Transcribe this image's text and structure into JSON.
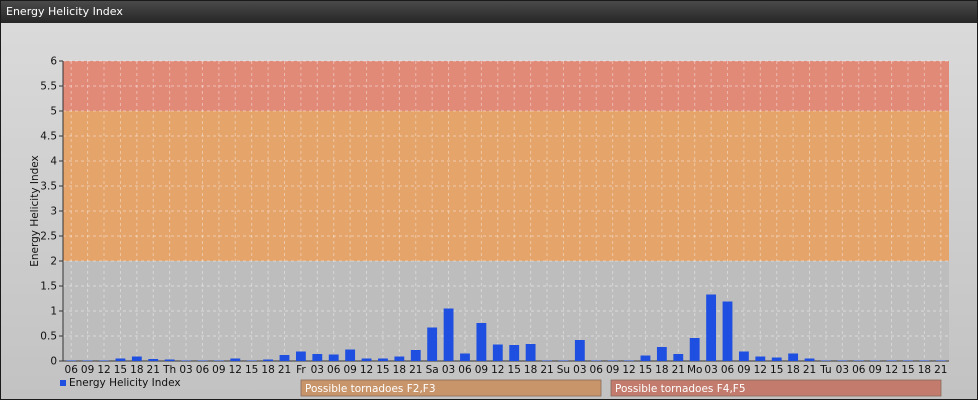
{
  "window": {
    "title": "Energy Helicity Index"
  },
  "chart_data": {
    "type": "bar",
    "ylabel": "Energy Helicity Index",
    "ylim": [
      0,
      6
    ],
    "yticks": [
      "0",
      "0.5",
      "1",
      "1.5",
      "2",
      "2.5",
      "3",
      "3.5",
      "4",
      "4.5",
      "5",
      "5.5",
      "6"
    ],
    "grid": true,
    "categories": [
      "06",
      "09",
      "12",
      "15",
      "18",
      "21",
      "Th",
      "03",
      "06",
      "09",
      "12",
      "15",
      "18",
      "21",
      "Fr",
      "03",
      "06",
      "09",
      "12",
      "15",
      "18",
      "21",
      "Sa",
      "03",
      "06",
      "09",
      "12",
      "15",
      "18",
      "21",
      "Su",
      "03",
      "06",
      "09",
      "12",
      "15",
      "18",
      "21",
      "Mo",
      "03",
      "06",
      "09",
      "12",
      "15",
      "18",
      "21",
      "Tu",
      "03",
      "06",
      "09",
      "12",
      "15",
      "18",
      "21"
    ],
    "series": [
      {
        "name": "Energy Helicity Index",
        "color": "#1f4fe0",
        "values": [
          0.01,
          0.01,
          0.01,
          0.05,
          0.09,
          0.04,
          0.03,
          0.01,
          0.01,
          0.01,
          0.05,
          0.01,
          0.03,
          0.12,
          0.19,
          0.14,
          0.13,
          0.23,
          0.05,
          0.05,
          0.09,
          0.22,
          0.67,
          1.05,
          0.15,
          0.76,
          0.33,
          0.32,
          0.34,
          0.01,
          0.01,
          0.42,
          0.01,
          0.01,
          0.01,
          0.11,
          0.28,
          0.14,
          0.46,
          1.33,
          1.19,
          0.19,
          0.09,
          0.07,
          0.15,
          0.05,
          0.01,
          0.01,
          0.01,
          0.01,
          0.01,
          0.01,
          0.01,
          0.01
        ]
      }
    ],
    "bands": [
      {
        "from": 2,
        "to": 5,
        "color": "#e4a46a",
        "label": "Possible tornadoes F2,F3",
        "legend_color": "#c8956a"
      },
      {
        "from": 5,
        "to": 6,
        "color": "#e28a78",
        "label": "Possible tornadoes F4,F5",
        "legend_color": "#c27b6c"
      }
    ],
    "legend_position": "bottom"
  }
}
